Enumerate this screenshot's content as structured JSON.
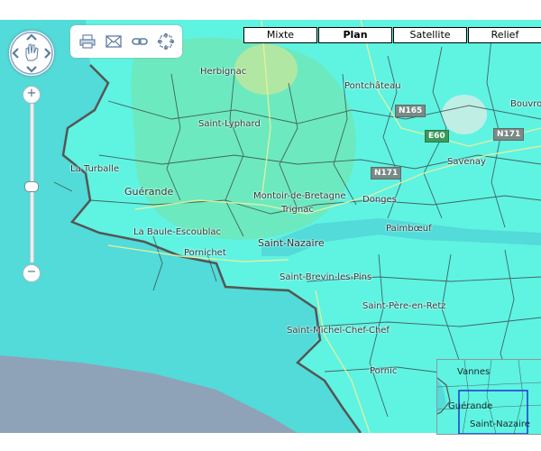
{
  "map_types": [
    {
      "label": "Mixte",
      "active": false
    },
    {
      "label": "Plan",
      "active": true
    },
    {
      "label": "Satellite",
      "active": false
    },
    {
      "label": "Relief",
      "active": false
    }
  ],
  "toolbar": {
    "print_icon": "print-icon",
    "email_icon": "email-icon",
    "link_icon": "link-icon",
    "fullscreen_icon": "fullscreen-icon"
  },
  "zoom": {
    "plus": "+",
    "minus": "−"
  },
  "places": {
    "herbignac": "Herbignac",
    "pontchateau": "Pontchâteau",
    "saint_lyphard": "Saint-Lyphard",
    "bouvron": "Bouvron",
    "la_turballe": "La Turballe",
    "guerande": "Guérande",
    "savenay": "Savenay",
    "montoir": "Montoir-de-Bretagne",
    "donges": "Donges",
    "trignac": "Trignac",
    "la_baule": "La Baule-Escoublac",
    "saint_nazaire": "Saint-Nazaire",
    "pornichet": "Pornichet",
    "paimboeuf": "Paimbœuf",
    "saint_brevin": "Saint-Brevin-les-Pins",
    "saint_pere": "Saint-Père-en-Retz",
    "saint_michel": "Saint-Michel-Chef-Chef",
    "pornic": "Pornic"
  },
  "roads": {
    "n165": "N165",
    "n171a": "N171",
    "n171b": "N171",
    "e60": "E60"
  },
  "overview": {
    "vannes": "Vannes",
    "guerande": "Guérande",
    "saint_nazaire": "Saint-Nazaire"
  },
  "colors": {
    "land": "#5ff3e2",
    "sea": "#52dbd8",
    "ocean_far": "#8fa3b8",
    "highlight": "#6ee6b8",
    "border": "#555555"
  }
}
